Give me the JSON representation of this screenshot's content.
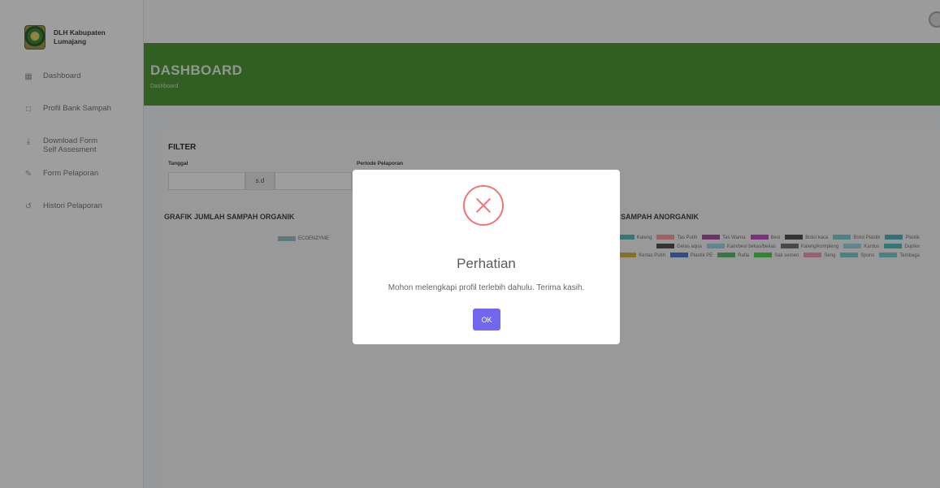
{
  "brand": {
    "line1": "DLH Kabupaten",
    "line2": "Lumajang"
  },
  "sidebar": {
    "items": [
      {
        "label": "Dashboard",
        "icon": "dashboard-icon"
      },
      {
        "label": "Profil Bank Sampah",
        "icon": "file-icon"
      },
      {
        "label": "Download Form Self Assesment",
        "icon": "download-icon"
      },
      {
        "label": "Form Pelaporan",
        "icon": "edit-icon"
      },
      {
        "label": "Histori Pelaporan",
        "icon": "history-icon"
      }
    ]
  },
  "header": {
    "title": "DASHBOARD",
    "breadcrumb": "Dashboard"
  },
  "filter": {
    "title": "FILTER",
    "tanggal_label": "Tanggal",
    "sd_label": "s.d",
    "periode_label": "Periode Pelaporan"
  },
  "charts": {
    "organik_title": "GRAFIK JUMLAH SAMPAH ORGANIK",
    "organik_legend": "ECOENZYME",
    "anorganik_title": "H SAMPAH ANORGANIK",
    "anorganik_legend": [
      {
        "label": "Kaleng",
        "color": "#4fc3c3"
      },
      {
        "label": "Tas Putih",
        "color": "#ff9f9f"
      },
      {
        "label": "Tas Warna",
        "color": "#b04fa8"
      },
      {
        "label": "Besi",
        "color": "#c94fc7"
      },
      {
        "label": "Botol kaca",
        "color": "#555555"
      },
      {
        "label": "Botol Plastik",
        "color": "#7fd0d0"
      },
      {
        "label": "Plastik",
        "color": "#4fb6c9"
      },
      {
        "label": "Gelas aqua",
        "color": "#555555"
      },
      {
        "label": "Kain/besi bekas/bekas",
        "color": "#9fd6e6"
      },
      {
        "label": "Kaleng/kompleng",
        "color": "#777777"
      },
      {
        "label": "Kardus",
        "color": "#9fd6e6"
      },
      {
        "label": "Duplex",
        "color": "#4fc3c3"
      },
      {
        "label": "Kertas Putih",
        "color": "#d9b44a"
      },
      {
        "label": "Plastik PE",
        "color": "#4f7fd6"
      },
      {
        "label": "Rafia",
        "color": "#5fbf6f"
      },
      {
        "label": "Sak semen",
        "color": "#4fd64f"
      },
      {
        "label": "Seng",
        "color": "#f29fb8"
      },
      {
        "label": "Spons",
        "color": "#7fd0d0"
      },
      {
        "label": "Tembaga",
        "color": "#7fd0d0"
      }
    ]
  },
  "modal": {
    "title": "Perhatian",
    "message": "Mohon melengkapi profil terlebih dahulu. Terima kasih.",
    "ok_label": "OK"
  },
  "colors": {
    "header_green": "#4f9a36",
    "ok_button": "#7367f0",
    "error_red": "#f27474"
  }
}
